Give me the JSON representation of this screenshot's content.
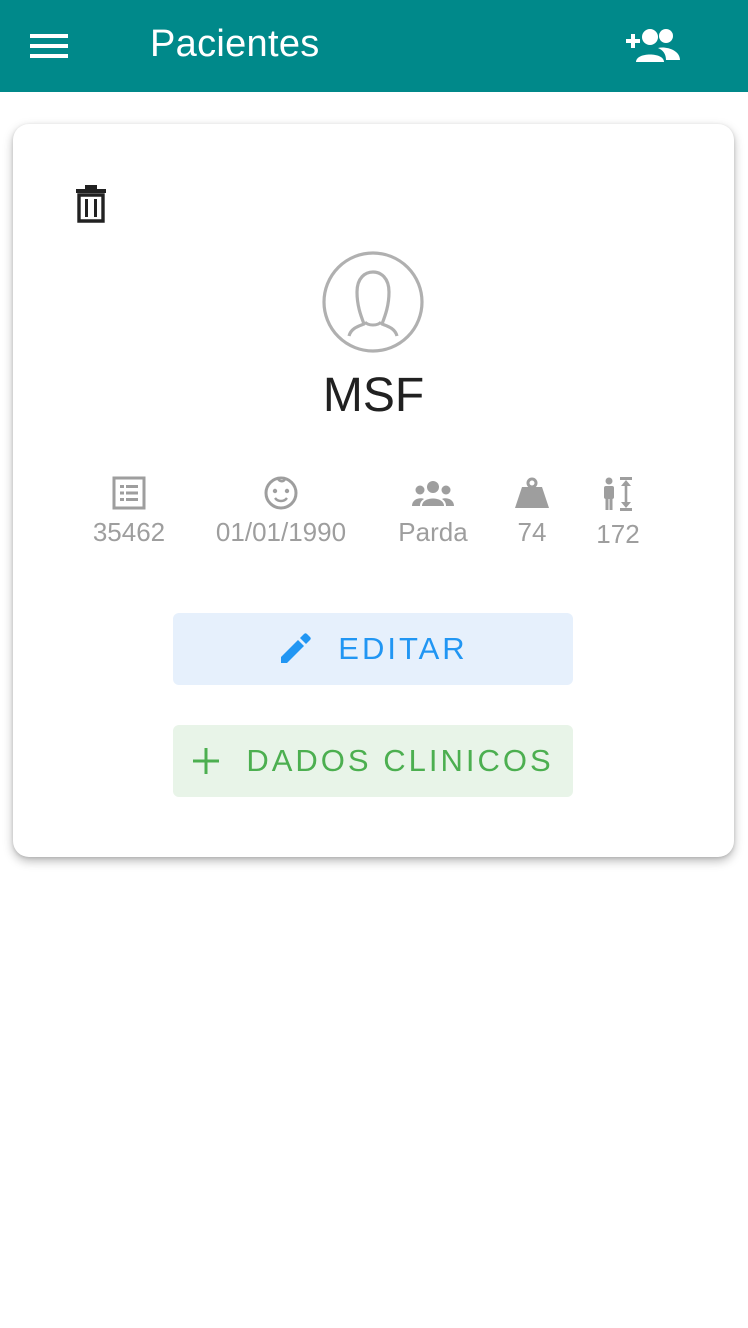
{
  "app_bar": {
    "title": "Pacientes",
    "background_color": "#00898a",
    "menu_icon": "menu-icon",
    "add_patient_icon": "person-add-icon"
  },
  "patient": {
    "name": "MSF",
    "avatar_icon": "female-avatar-icon",
    "delete_icon": "trash-icon",
    "info": [
      {
        "icon": "id-card-icon",
        "value": "35462"
      },
      {
        "icon": "baby-face-icon",
        "value": "01/01/1990"
      },
      {
        "icon": "group-icon",
        "value": "Parda"
      },
      {
        "icon": "weight-icon",
        "value": "74"
      },
      {
        "icon": "height-icon",
        "value": "172"
      }
    ]
  },
  "actions": {
    "edit_label": "EDITAR",
    "edit_icon": "pencil-icon",
    "edit_color": "#2196f3",
    "clinical_label": "DADOS CLINICOS",
    "clinical_icon": "plus-icon",
    "clinical_color": "#4caf50"
  }
}
